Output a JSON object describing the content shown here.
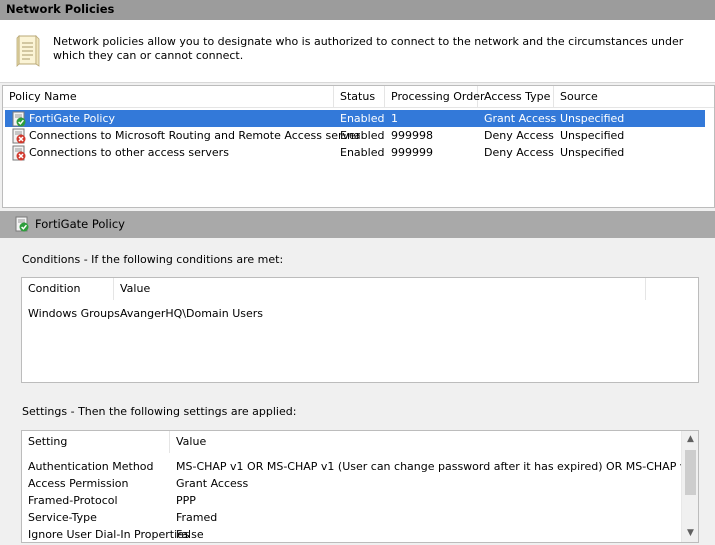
{
  "window": {
    "title": "Network Policies"
  },
  "intro": {
    "text": "Network policies allow you to designate who is authorized to connect to the network and the circumstances under which they can or cannot connect."
  },
  "policy_table": {
    "columns": [
      "Policy Name",
      "Status",
      "Processing Order",
      "Access Type",
      "Source"
    ],
    "rows": [
      {
        "name": "FortiGate Policy",
        "status": "Enabled",
        "order": "1",
        "access": "Grant Access",
        "source": "Unspecified",
        "icon": "policy-grant-icon"
      },
      {
        "name": "Connections to Microsoft Routing and Remote Access server",
        "status": "Enabled",
        "order": "999998",
        "access": "Deny Access",
        "source": "Unspecified",
        "icon": "policy-deny-icon"
      },
      {
        "name": "Connections to other access servers",
        "status": "Enabled",
        "order": "999999",
        "access": "Deny Access",
        "source": "Unspecified",
        "icon": "policy-deny-icon"
      }
    ]
  },
  "details": {
    "title": "FortiGate Policy",
    "conditions_label": "Conditions - If the following conditions are met:",
    "conditions_columns": [
      "Condition",
      "Value"
    ],
    "conditions": [
      {
        "condition": "Windows Groups",
        "value": "AvangerHQ\\Domain Users"
      }
    ],
    "settings_label": "Settings - Then the following settings are applied:",
    "settings_columns": [
      "Setting",
      "Value"
    ],
    "settings": [
      {
        "setting": "Authentication Method",
        "value": "MS-CHAP v1 OR MS-CHAP v1 (User can change password after it has expired) OR MS-CHAP v..."
      },
      {
        "setting": "Access Permission",
        "value": "Grant Access"
      },
      {
        "setting": "Framed-Protocol",
        "value": "PPP"
      },
      {
        "setting": "Service-Type",
        "value": "Framed"
      },
      {
        "setting": "Ignore User Dial-In Properties",
        "value": "False"
      }
    ]
  },
  "colors": {
    "selection": "#3379d9",
    "header_bar": "#9c9c9c",
    "detail_bar": "#a9a9a9"
  }
}
